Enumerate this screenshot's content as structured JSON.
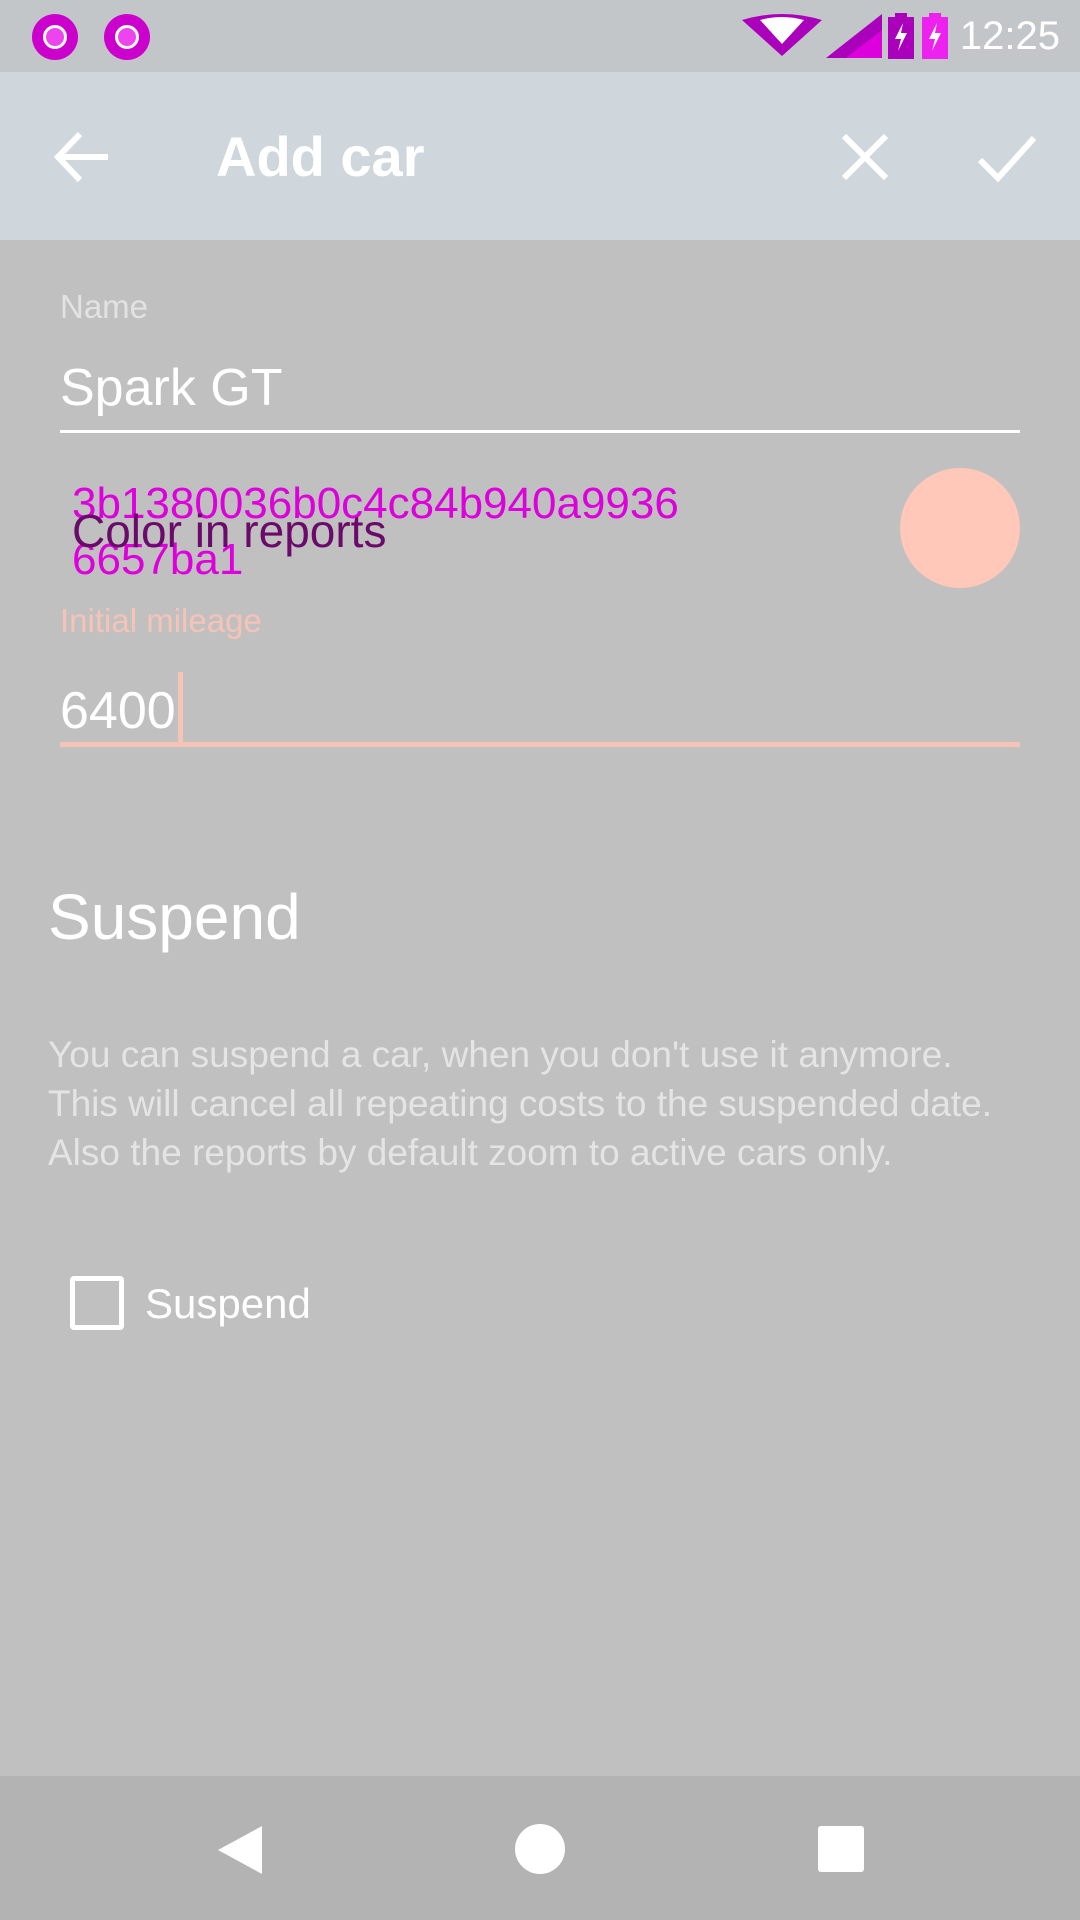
{
  "status_bar": {
    "time": "12:25",
    "icons": [
      "notification-icon",
      "notification-icon",
      "wifi-icon",
      "signal-icon",
      "battery-icon"
    ]
  },
  "app_bar": {
    "title": "Add car",
    "back_icon": "arrow-back-icon",
    "close_icon": "close-icon",
    "confirm_icon": "check-icon"
  },
  "form": {
    "name_label": "Name",
    "name_value": "Spark GT",
    "color_overlay_line1": "3b1380036b0c4c84b940a9936",
    "color_overlay_line2": "6657ba1",
    "color_label": "Color in reports",
    "color_swatch": "#ffc8b8",
    "mileage_label": "Initial mileage",
    "mileage_value": "6400"
  },
  "suspend": {
    "title": "Suspend",
    "description": "You can suspend a car, when you don't use it anymore. This will cancel all repeating costs to the suspended date. Also the reports by default zoom to active cars only.",
    "checkbox_label": "Suspend",
    "checked": false
  },
  "colors": {
    "accent": "#f6c3b7",
    "overlay": "#dd00dd"
  },
  "nav_bar": {
    "icons": [
      "nav-back-icon",
      "nav-home-icon",
      "nav-recents-icon"
    ]
  }
}
